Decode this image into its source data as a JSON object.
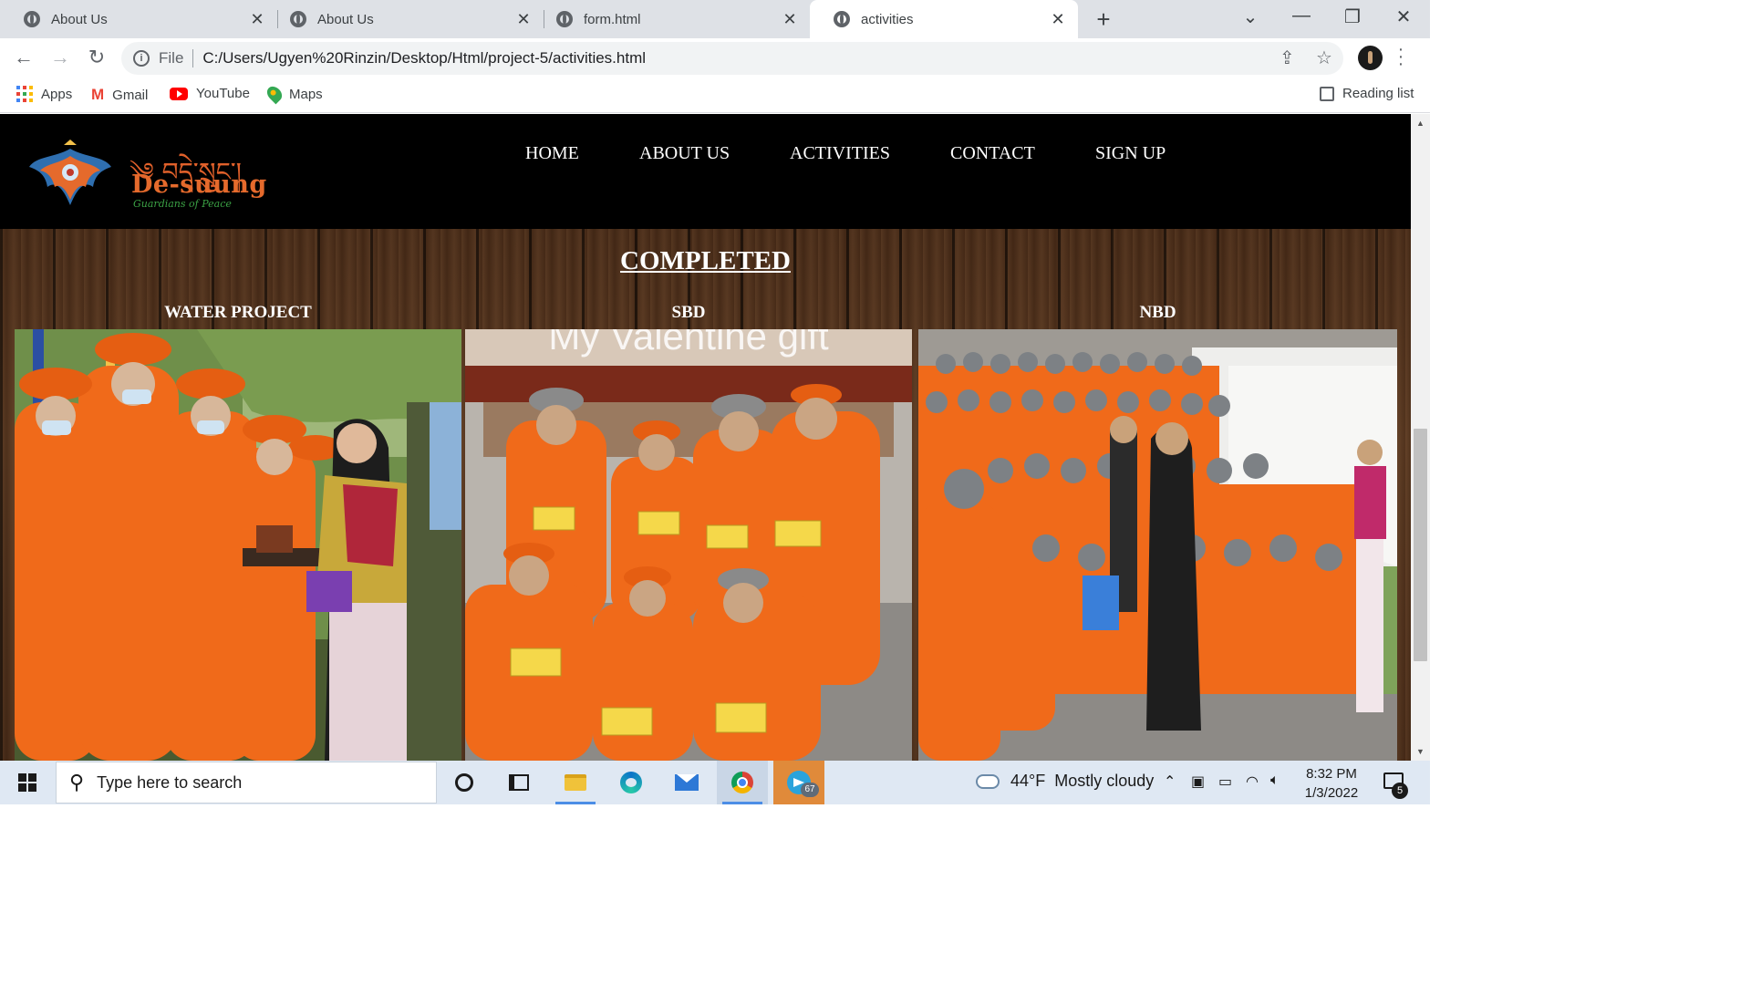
{
  "browser": {
    "tabs": [
      {
        "title": "About Us",
        "active": false
      },
      {
        "title": "About Us",
        "active": false
      },
      {
        "title": "form.html",
        "active": false
      },
      {
        "title": "activities",
        "active": true
      }
    ],
    "new_tab_symbol": "+",
    "close_symbol": "✕",
    "address": {
      "scheme_label": "File",
      "url": "C:/Users/Ugyen%20Rinzin/Desktop/Html/project-5/activities.html"
    },
    "bookmarks": [
      {
        "label": "Apps",
        "icon": "apps-grid-icon"
      },
      {
        "label": "Gmail",
        "icon": "gmail-icon"
      },
      {
        "label": "YouTube",
        "icon": "youtube-icon"
      },
      {
        "label": "Maps",
        "icon": "maps-icon"
      }
    ],
    "reading_list_label": "Reading list"
  },
  "site": {
    "logo": {
      "script": "༄ བདེ་སྲུང་།",
      "name": "De-suung",
      "tagline": "Guardians of Peace"
    },
    "nav": [
      "HOME",
      "ABOUT US",
      "ACTIVITIES",
      "CONTACT",
      "SIGN UP"
    ],
    "section_title": "COMPLETED",
    "projects": [
      {
        "label": "WATER PROJECT"
      },
      {
        "label": "SBD"
      },
      {
        "label": "NBD"
      }
    ],
    "photo_overlay_text": "My Valentine gift"
  },
  "taskbar": {
    "search_placeholder": "Type here to search",
    "telegram_badge": "67",
    "weather": {
      "temp": "44°F",
      "condition": "Mostly cloudy"
    },
    "time": "8:32 PM",
    "date": "1/3/2022",
    "notification_count": "5"
  },
  "colors": {
    "nav_bg": "#000000",
    "wood": "#4a2c18",
    "uniform_orange": "#f06a1a",
    "brand_orange": "#e56a2c",
    "brand_green": "#3ba245"
  }
}
